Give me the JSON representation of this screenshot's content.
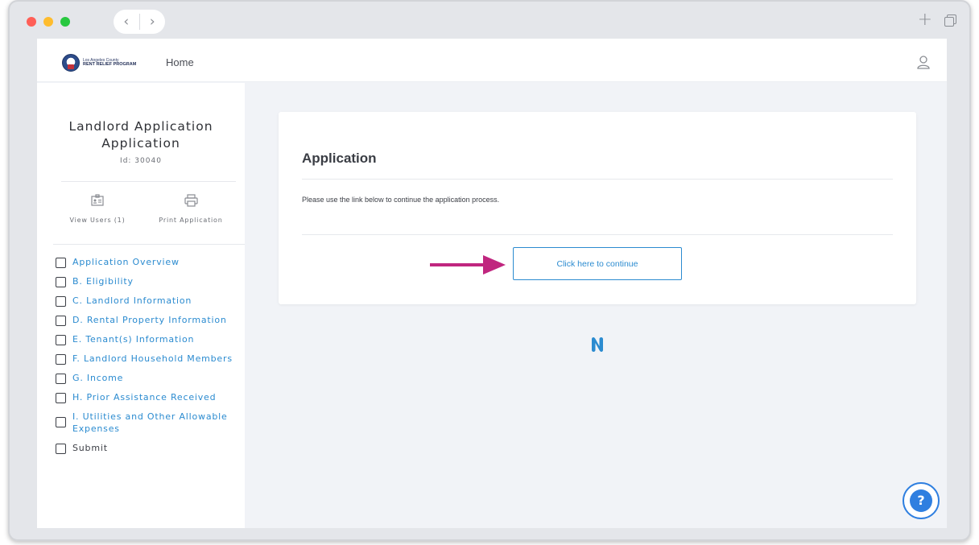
{
  "header": {
    "logo_line1": "Los Angeles County",
    "logo_line2": "RENT RELIEF PROGRAM",
    "home_label": "Home"
  },
  "sidebar": {
    "title": "Landlord Application Application",
    "id_label": "Id: 30040",
    "view_users_label": "View Users (1)",
    "print_label": "Print Application",
    "items": [
      {
        "label": "Application Overview"
      },
      {
        "label": "B. Eligibility"
      },
      {
        "label": "C. Landlord Information"
      },
      {
        "label": "D. Rental Property Information"
      },
      {
        "label": "E. Tenant(s) Information"
      },
      {
        "label": "F. Landlord Household Members"
      },
      {
        "label": "G. Income"
      },
      {
        "label": "H. Prior Assistance Received"
      },
      {
        "label": "I. Utilities and Other Allowable Expenses"
      },
      {
        "label": "Submit"
      }
    ]
  },
  "card": {
    "title": "Application",
    "description": "Please use the link below to continue the application process.",
    "button_label": "Click here to continue"
  },
  "help": {
    "label": "?"
  },
  "colors": {
    "link_blue": "#2b8bd0",
    "arrow_magenta": "#c0267f",
    "help_blue": "#2f7fe0",
    "content_bg": "#f1f3f7"
  },
  "icons": {
    "nav_back": "chevron-left-icon",
    "nav_forward": "chevron-right-icon",
    "new_tab": "plus-icon",
    "tabs": "tabs-icon",
    "user": "user-icon",
    "view_users": "id-card-icon",
    "print": "printer-icon"
  }
}
